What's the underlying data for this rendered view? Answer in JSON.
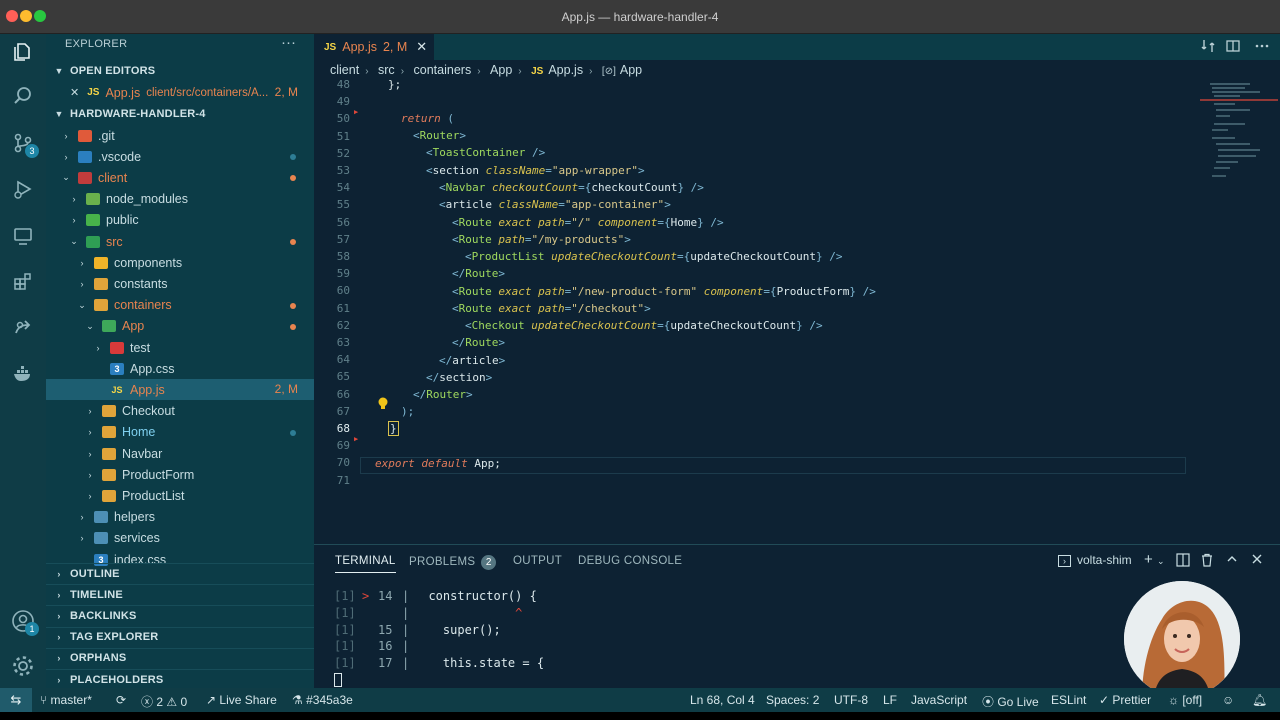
{
  "window": {
    "title": "App.js — hardware-handler-4"
  },
  "activity_bar": {
    "source_control_badge": "3",
    "accounts_badge": "1"
  },
  "sidebar": {
    "header": "EXPLORER",
    "more": "···",
    "open_editors": {
      "label": "OPEN EDITORS",
      "items": [
        {
          "close": "✕",
          "icon": "JS",
          "name": "App.js",
          "path": "client/src/containers/A...",
          "status": "2, M"
        }
      ]
    },
    "project": {
      "label": "HARDWARE-HANDLER-4",
      "tree": [
        {
          "name": ".git",
          "status": ""
        },
        {
          "name": ".vscode",
          "status": ""
        },
        {
          "name": "client",
          "status": ""
        },
        {
          "name": "node_modules",
          "status": ""
        },
        {
          "name": "public",
          "status": ""
        },
        {
          "name": "src",
          "status": ""
        },
        {
          "name": "components",
          "status": ""
        },
        {
          "name": "constants",
          "status": ""
        },
        {
          "name": "containers",
          "status": ""
        },
        {
          "name": "App",
          "status": ""
        },
        {
          "name": "test",
          "status": ""
        },
        {
          "name": "App.css",
          "status": ""
        },
        {
          "name": "App.js",
          "status": "2, M"
        },
        {
          "name": "Checkout",
          "status": ""
        },
        {
          "name": "Home",
          "status": ""
        },
        {
          "name": "Navbar",
          "status": ""
        },
        {
          "name": "ProductForm",
          "status": ""
        },
        {
          "name": "ProductList",
          "status": ""
        },
        {
          "name": "helpers",
          "status": ""
        },
        {
          "name": "services",
          "status": ""
        },
        {
          "name": "index.css",
          "status": ""
        }
      ]
    },
    "sections": [
      "OUTLINE",
      "TIMELINE",
      "BACKLINKS",
      "TAG EXPLORER",
      "ORPHANS",
      "PLACEHOLDERS"
    ]
  },
  "editor": {
    "tab": {
      "icon": "JS",
      "name": "App.js",
      "status": "2, M",
      "close": "✕"
    },
    "breadcrumbs": [
      "client",
      "src",
      "containers",
      "App",
      "App.js",
      "App"
    ],
    "breadcrumb_js_icon": "JS",
    "breadcrumb_symbol_icon": "[⊘]",
    "line_numbers": [
      "48",
      "49",
      "50",
      "51",
      "52",
      "53",
      "54",
      "55",
      "56",
      "57",
      "58",
      "59",
      "60",
      "61",
      "62",
      "63",
      "64",
      "65",
      "66",
      "67",
      "68",
      "69",
      "70",
      "71"
    ],
    "current_line": "68"
  },
  "panel": {
    "tabs": [
      "TERMINAL",
      "PROBLEMS",
      "OUTPUT",
      "DEBUG CONSOLE"
    ],
    "problems_badge": "2",
    "terminal_name": "volta-shim",
    "terminal_lines": [
      {
        "prefix": "[1]",
        "marker": ">",
        "num": "14",
        "bar": "|",
        "code": "  constructor() {"
      },
      {
        "prefix": "[1]",
        "marker": "",
        "num": "",
        "bar": "|",
        "code": "              ^"
      },
      {
        "prefix": "[1]",
        "marker": "",
        "num": "15",
        "bar": "|",
        "code": "    super();"
      },
      {
        "prefix": "[1]",
        "marker": "",
        "num": "16",
        "bar": "|",
        "code": ""
      },
      {
        "prefix": "[1]",
        "marker": "",
        "num": "17",
        "bar": "|",
        "code": "    this.state = {"
      }
    ]
  },
  "status_bar": {
    "branch": "master*",
    "errors": "2",
    "warnings": "0",
    "live_share": "Live Share",
    "color": "#345a3e",
    "position": "Ln 68, Col 4",
    "spaces": "Spaces: 2",
    "encoding": "UTF-8",
    "eol": "LF",
    "language": "JavaScript",
    "go_live": "Go Live",
    "eslint": "ESLint",
    "prettier": "Prettier",
    "off": "[off]"
  },
  "colors": {
    "accent": "#1e86a6",
    "modified": "#e8844f",
    "js": "#f5d547",
    "sidebar_bg": "#0c3c47",
    "editor_bg": "#0d2233"
  }
}
